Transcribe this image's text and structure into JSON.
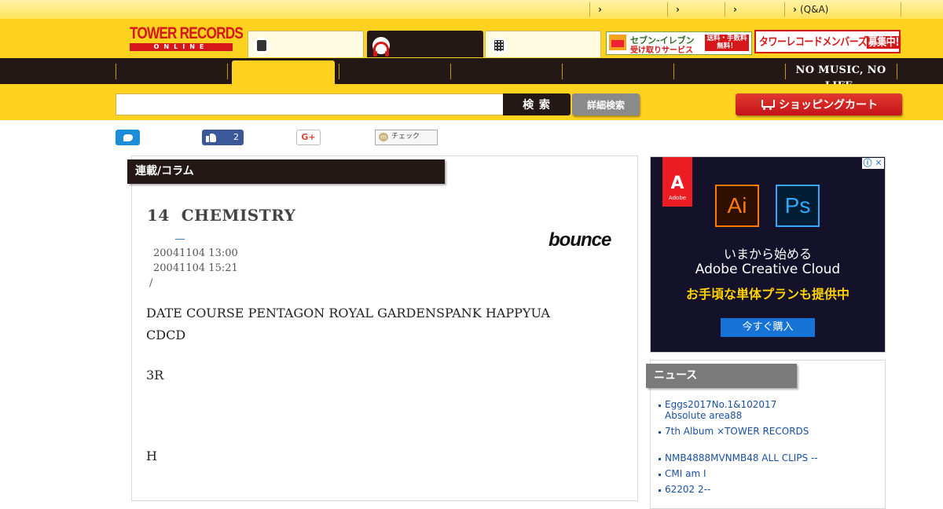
{
  "topbar": {
    "links": [
      "",
      "",
      "",
      "(Q&A)"
    ]
  },
  "header": {
    "logo_line1": "TOWER RECORDS",
    "logo_line2": "ONLINE",
    "tabs": [
      {
        "label": "",
        "icon": "phone-icon"
      },
      {
        "label": "",
        "icon": "headphones-icon"
      },
      {
        "label": "",
        "icon": "calculator-icon"
      }
    ],
    "banner_711_line1": "セブン-イレブン",
    "banner_711_line2": "受け取りサービス",
    "banner_711_tag": "送料・手数料無料！",
    "banner_member_prefix": "タワーレコードメンバーズ",
    "banner_member_suffix": "募集中!"
  },
  "nav": {
    "slogan": "NO MUSIC, NO LIFE."
  },
  "search": {
    "value": "",
    "button_label": "検 索",
    "advanced_label": "詳細検索",
    "cart_label": "ショッピングカート"
  },
  "social": {
    "like_count": "2",
    "gplus_label": "G+",
    "mixi_label": "チェック"
  },
  "article": {
    "section_label": "連載/コラム",
    "title": "14  CHEMISTRY",
    "brand": "bounce",
    "published": "20041104 13:00",
    "updated": "20041104 15:21",
    "slash": "/",
    "paragraphs": [
      "DATE COURSE PENTAGON ROYAL GARDENSPANK HAPPYUA",
      "CDCD",
      "3R",
      "H"
    ]
  },
  "ad": {
    "brand": "Adobe",
    "app1": "Ai",
    "app2": "Ps",
    "line1": "いまから始める",
    "line2": "Adobe Creative Cloud",
    "line3": "お手頃な単体プランも提供中",
    "cta": "今すぐ購入",
    "info_icon": "ⓘ",
    "close_icon": "✕"
  },
  "news": {
    "label": "ニュース",
    "items": [
      "Eggs2017No.1&102017",
      "Absolute area88",
      " 7th Album ×TOWER RECORDS",
      "NMB4888MVNMB48 ALL CLIPS --",
      "CMI am I",
      "62202 2--"
    ]
  },
  "colors": {
    "brand_yellow": "#ffd21f",
    "brand_red": "#d61719",
    "nav_black": "#231815",
    "link_blue": "#1a4fa0"
  }
}
